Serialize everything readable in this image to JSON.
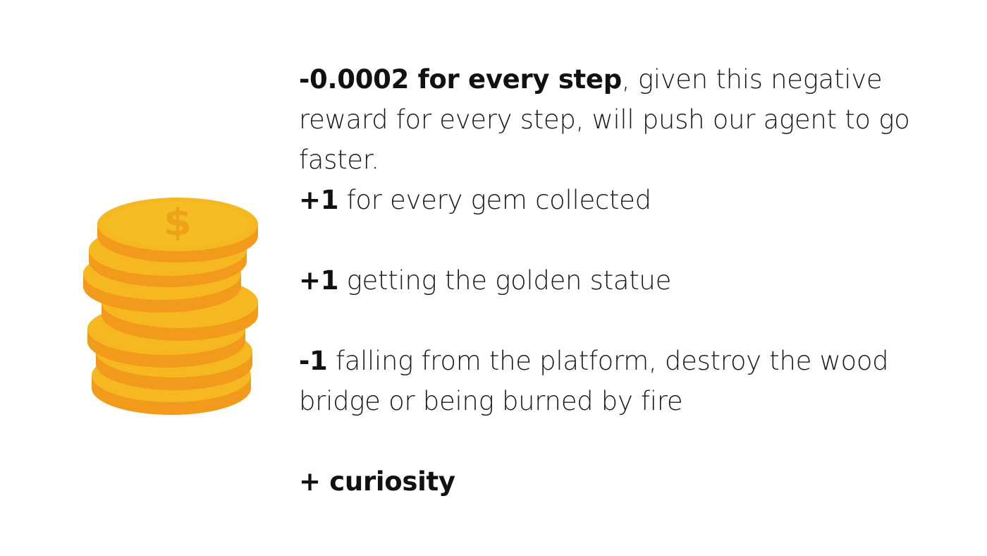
{
  "icon": "coin-stack-icon",
  "colors": {
    "coin_face": "#F5B820",
    "coin_edge": "#F29A1B",
    "coin_symbol": "#EDA21A",
    "text": "#1a1a1a"
  },
  "rewards": [
    {
      "value": "-0.0002 for every step",
      "description": ", given this negative reward for every step, will push our agent to go faster."
    },
    {
      "value": "+1",
      "description": " for every gem collected"
    },
    {
      "value": "+1",
      "description": " getting the golden statue"
    },
    {
      "value": "-1",
      "description": " falling from the platform, destroy the wood bridge or being burned by fire"
    },
    {
      "value": "+ curiosity",
      "description": ""
    }
  ]
}
